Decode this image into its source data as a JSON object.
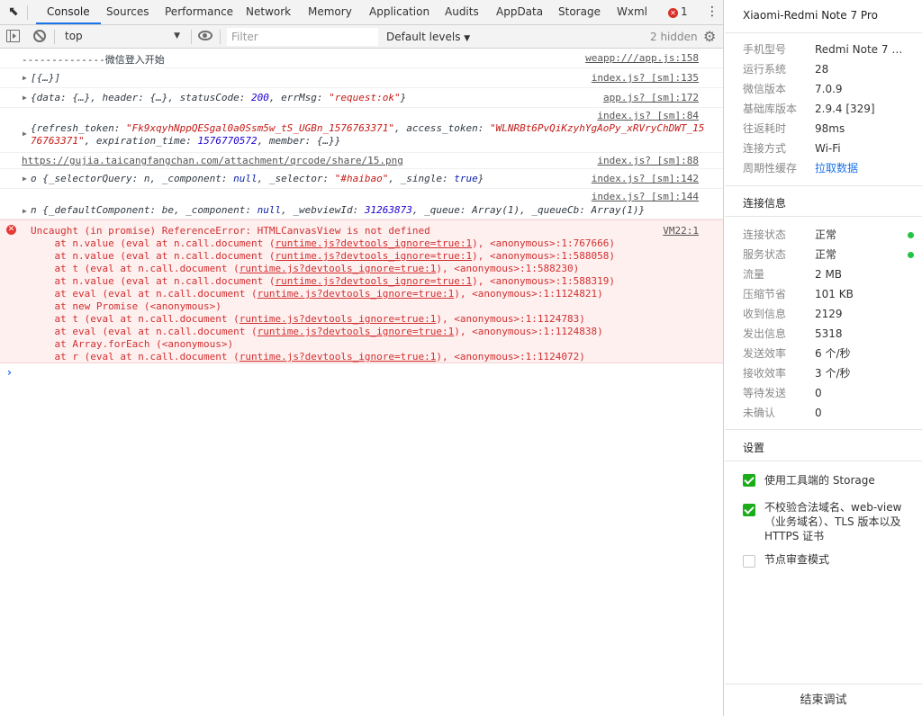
{
  "tabs": [
    "Console",
    "Sources",
    "Performance",
    "Network",
    "Memory",
    "Application",
    "Audits",
    "AppData",
    "Storage",
    "Wxml"
  ],
  "error_count": "1",
  "toolbar": {
    "context": "top",
    "filter_placeholder": "Filter",
    "levels": "Default levels",
    "hidden": "2 hidden"
  },
  "messages": {
    "m1": {
      "text": "--------------微信登入开始",
      "source": "weapp:///app.js:158"
    },
    "m2": {
      "text": "[{…}]",
      "source": "index.js? [sm]:135"
    },
    "m3": {
      "source": "app.js? [sm]:172",
      "p1": "{data: {…}, header: {…}, statusCode: ",
      "v1": "200",
      "p2": ", errMsg: ",
      "v2": "\"request:ok\"",
      "p3": "}"
    },
    "m4": {
      "source": "index.js? [sm]:84",
      "p1": "{refresh_token: ",
      "v1": "\"Fk9xqyhNppQESgal0a0Ssm5w_tS_UGBn_1576763371\"",
      "p2": ", access_token: ",
      "v2": "\"WLNRBt6PvQiKzyhYgAoPy_xRVryChDWT_15",
      "v2b": "76763371\"",
      "p3": ", expiration_time: ",
      "v3": "1576770572",
      "p4": ", member: {…}}"
    },
    "m5": {
      "text": "https://gujia.taicangfangchan.com/attachment/qrcode/share/15.png",
      "source": "index.js? [sm]:88"
    },
    "m6": {
      "source": "index.js? [sm]:142",
      "p1": "o {_selectorQuery: n, _component: ",
      "v1": "null",
      "p2": ", _selector: ",
      "v2": "\"#haibao\"",
      "p3": ", _single: ",
      "v3": "true",
      "p4": "}"
    },
    "m7": {
      "source": "index.js? [sm]:144",
      "p1": "n {_defaultComponent: be, _component: ",
      "v1": "null",
      "p2": ", _webviewId: ",
      "v2": "31263873",
      "p3": ", _queue: Array(1), _queueCb: Array(1)}"
    }
  },
  "error": {
    "source": "VM22:1",
    "head": "Uncaught (in promise) ReferenceError: HTMLCanvasView is not defined",
    "lines": [
      {
        "pre": "    at n.value (eval at n.call.document (",
        "link": "runtime.js?devtools_ignore=true:1",
        "post": "), <anonymous>:1:767666)"
      },
      {
        "pre": "    at n.value (eval at n.call.document (",
        "link": "runtime.js?devtools_ignore=true:1",
        "post": "), <anonymous>:1:588058)"
      },
      {
        "pre": "    at t (eval at n.call.document (",
        "link": "runtime.js?devtools_ignore=true:1",
        "post": "), <anonymous>:1:588230)"
      },
      {
        "pre": "    at n.value (eval at n.call.document (",
        "link": "runtime.js?devtools_ignore=true:1",
        "post": "), <anonymous>:1:588319)"
      },
      {
        "pre": "    at eval (eval at n.call.document (",
        "link": "runtime.js?devtools_ignore=true:1",
        "post": "), <anonymous>:1:1124821)"
      },
      {
        "pre": "    at new Promise (<anonymous>)",
        "link": "",
        "post": ""
      },
      {
        "pre": "    at t (eval at n.call.document (",
        "link": "runtime.js?devtools_ignore=true:1",
        "post": "), <anonymous>:1:1124783)"
      },
      {
        "pre": "    at eval (eval at n.call.document (",
        "link": "runtime.js?devtools_ignore=true:1",
        "post": "), <anonymous>:1:1124838)"
      },
      {
        "pre": "    at Array.forEach (<anonymous>)",
        "link": "",
        "post": ""
      },
      {
        "pre": "    at r (eval at n.call.document (",
        "link": "runtime.js?devtools_ignore=true:1",
        "post": "), <anonymous>:1:1124072)"
      }
    ]
  },
  "device": {
    "title": "Xiaomi-Redmi Note 7 Pro",
    "rows": [
      {
        "k": "手机型号",
        "v": "Redmi Note 7 Pr..."
      },
      {
        "k": "运行系统",
        "v": "28"
      },
      {
        "k": "微信版本",
        "v": "7.0.9"
      },
      {
        "k": "基础库版本",
        "v": "2.9.4 [329]"
      },
      {
        "k": "往返耗时",
        "v": "98ms"
      },
      {
        "k": "连接方式",
        "v": "Wi-Fi"
      },
      {
        "k": "周期性缓存",
        "v": "拉取数据"
      }
    ]
  },
  "connection": {
    "title": "连接信息",
    "rows": [
      {
        "k": "连接状态",
        "v": "正常"
      },
      {
        "k": "服务状态",
        "v": "正常"
      },
      {
        "k": "流量",
        "v": "2 MB"
      },
      {
        "k": "压缩节省",
        "v": "101 KB"
      },
      {
        "k": "收到信息",
        "v": "2129"
      },
      {
        "k": "发出信息",
        "v": "5318"
      },
      {
        "k": "发送效率",
        "v": "6 个/秒"
      },
      {
        "k": "接收效率",
        "v": "3 个/秒"
      },
      {
        "k": "等待发送",
        "v": "0"
      },
      {
        "k": "未确认",
        "v": "0"
      }
    ]
  },
  "settings": {
    "title": "设置",
    "items": [
      {
        "label": "使用工具端的 Storage",
        "checked": true
      },
      {
        "label": "不校验合法域名、web-view（业务域名）、TLS 版本以及 HTTPS 证书",
        "checked": true
      },
      {
        "label": "节点审查模式",
        "checked": false
      }
    ]
  },
  "end_button": "结束调试",
  "colors": {
    "accent": "#1a73e8",
    "error_bg": "#fff0f0",
    "error_text": "#d12f2f",
    "ok_dot": "#23c343",
    "checkbox_on": "#1aad19"
  }
}
